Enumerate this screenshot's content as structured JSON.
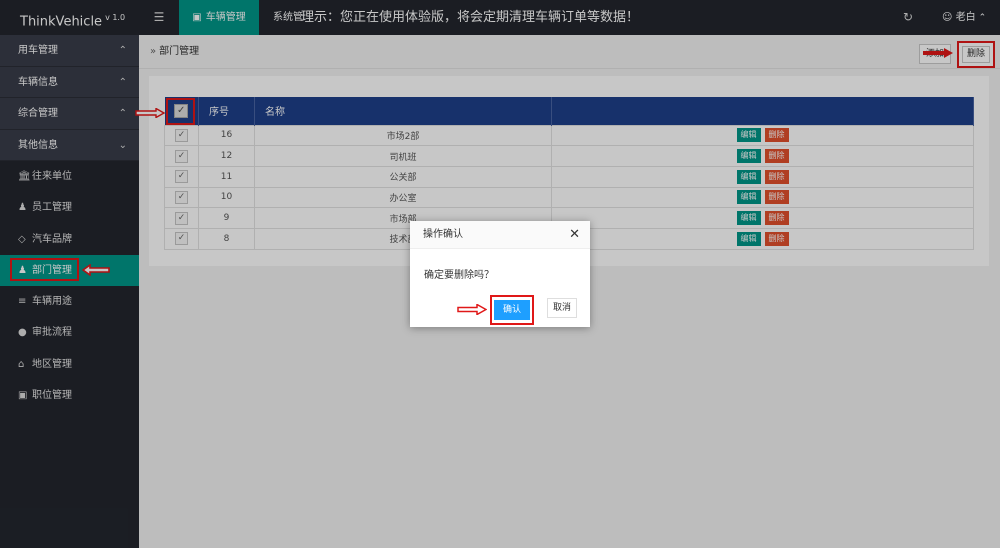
{
  "app": {
    "name": "ThinkVehicle",
    "version": "v 1.0"
  },
  "topbar": {
    "menu_icon": "hamburger-icon",
    "active_tab": "车辆管理",
    "tab2": "系统管",
    "notice": "理示：您正在使用体验版，将会定期清理车辆订单等数据！",
    "user": "老白"
  },
  "sidebar": {
    "groups": [
      {
        "label": "用车管理",
        "arrow": "^"
      },
      {
        "label": "车辆信息",
        "arrow": "^"
      },
      {
        "label": "综合管理",
        "arrow": "^"
      },
      {
        "label": "其他信息",
        "arrow": "v"
      }
    ],
    "items": [
      {
        "label": "往来单位",
        "icon": "bank-icon"
      },
      {
        "label": "员工管理",
        "icon": "user-icon"
      },
      {
        "label": "汽车品牌",
        "icon": "diamond-icon"
      },
      {
        "label": "部门管理",
        "icon": "group-icon"
      },
      {
        "label": "车辆用途",
        "icon": "list-icon"
      },
      {
        "label": "审批流程",
        "icon": "android-icon"
      },
      {
        "label": "地区管理",
        "icon": "home-icon"
      },
      {
        "label": "职位管理",
        "icon": "camera-icon"
      }
    ]
  },
  "breadcrumb": {
    "label": "部门管理"
  },
  "toolbar": {
    "add_label": "添加",
    "delete_label": "删除"
  },
  "table": {
    "headers": [
      "序号",
      "名称"
    ],
    "rows": [
      {
        "id": "16",
        "name": "市场2部"
      },
      {
        "id": "12",
        "name": "司机班"
      },
      {
        "id": "11",
        "name": "公关部"
      },
      {
        "id": "10",
        "name": "办公室"
      },
      {
        "id": "9",
        "name": "市场部"
      },
      {
        "id": "8",
        "name": "技术部"
      }
    ],
    "edit_label": "编辑",
    "delete_label": "删除"
  },
  "dialog": {
    "title": "操作确认",
    "message": "确定要删除吗？",
    "ok_label": "确认",
    "cancel_label": "取消"
  },
  "colors": {
    "accent": "#009688",
    "header": "#1e3f8a",
    "danger": "#e2502c",
    "primary": "#1e9fff",
    "highlight": "#e01818"
  }
}
